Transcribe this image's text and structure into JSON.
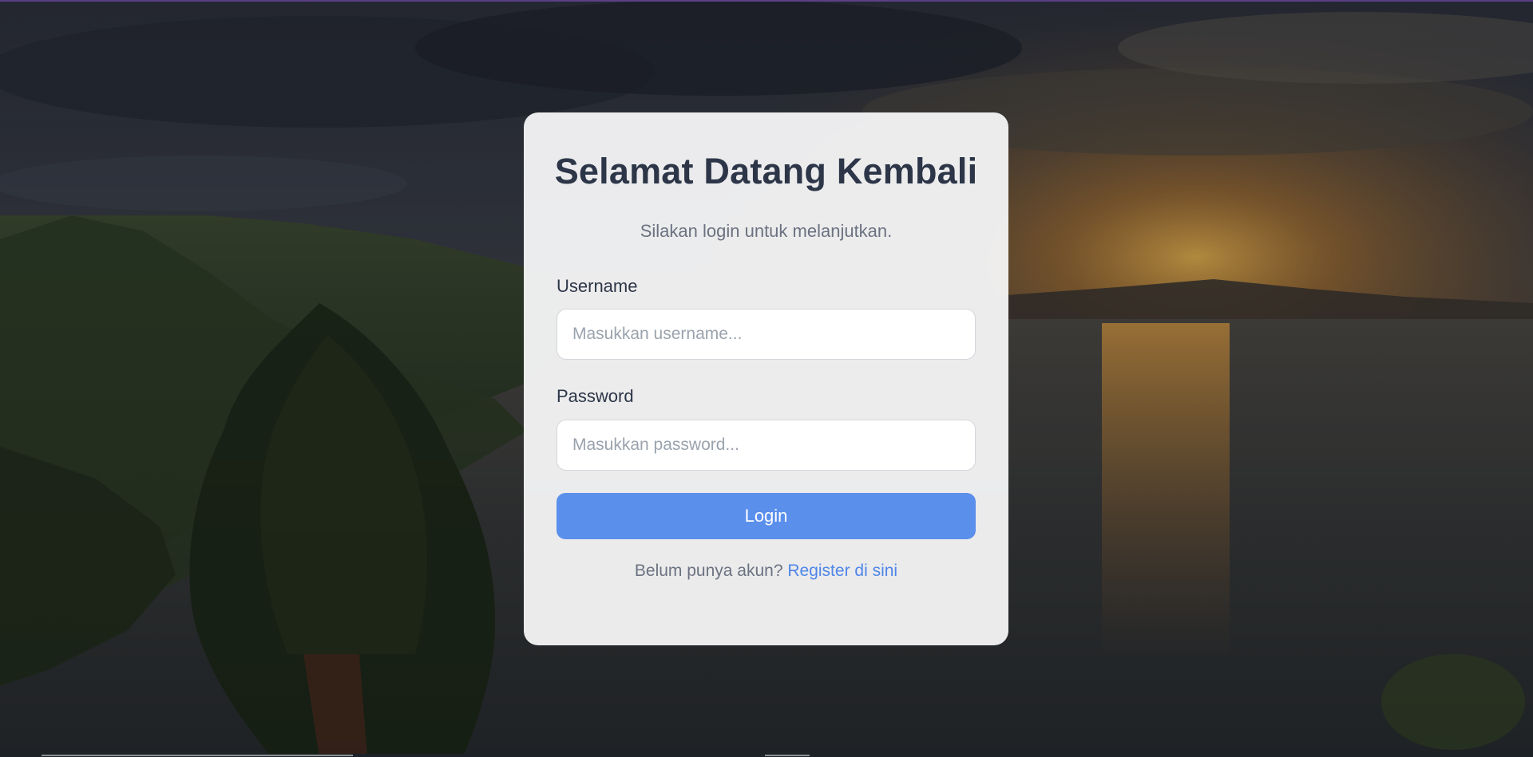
{
  "colors": {
    "card_background": "#f4f4f5",
    "title_text": "#2d3648",
    "muted_text": "#6b7280",
    "button_primary": "#5b8fec",
    "link": "#4f86e8"
  },
  "login": {
    "title": "Selamat Datang Kembali",
    "subtitle": "Silakan login untuk melanjutkan.",
    "username_label": "Username",
    "username_placeholder": "Masukkan username...",
    "username_value": "",
    "password_label": "Password",
    "password_placeholder": "Masukkan password...",
    "password_value": "",
    "submit_label": "Login",
    "register_prompt": "Belum punya akun?",
    "register_link": "Register di sini"
  }
}
